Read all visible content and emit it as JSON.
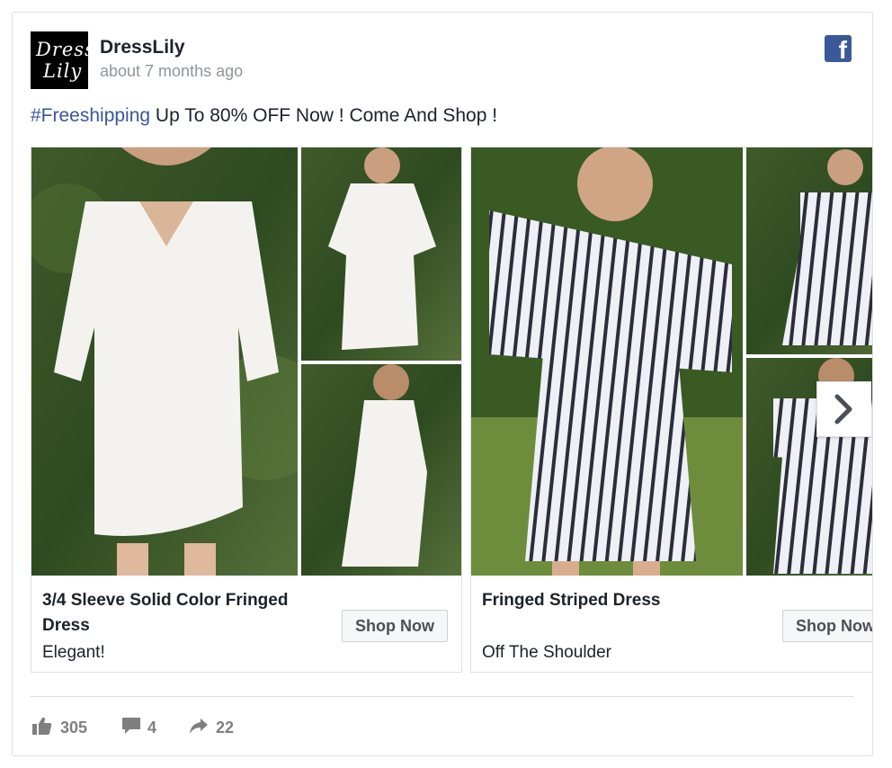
{
  "page": {
    "name": "DressLily",
    "logo_line1": "Dress",
    "logo_line2": "Lily",
    "time": "about 7 months ago"
  },
  "post": {
    "hashtag": "#Freeshipping",
    "message": " Up To 80% OFF Now ! Come And Shop !"
  },
  "carousel": {
    "cards": [
      {
        "title": "3/4 Sleeve Solid Color Fringed Dress",
        "description": "Elegant!",
        "cta": "Shop Now",
        "dress_color": "#f4f2ee"
      },
      {
        "title": "Fringed Striped Dress",
        "description": "Off The Shoulder",
        "cta": "Shop Now",
        "dress_color": "#e8eaf2"
      }
    ]
  },
  "stats": {
    "likes": "305",
    "comments": "4",
    "shares": "22"
  },
  "icons": {
    "brand": "facebook-icon",
    "next": "chevron-right-icon",
    "like": "thumbs-up-icon",
    "comment": "comment-icon",
    "share": "share-arrow-icon"
  },
  "colors": {
    "hashtag": "#365899",
    "facebook": "#3b5998",
    "muted": "#90949c",
    "stats": "#7f7f7f"
  }
}
